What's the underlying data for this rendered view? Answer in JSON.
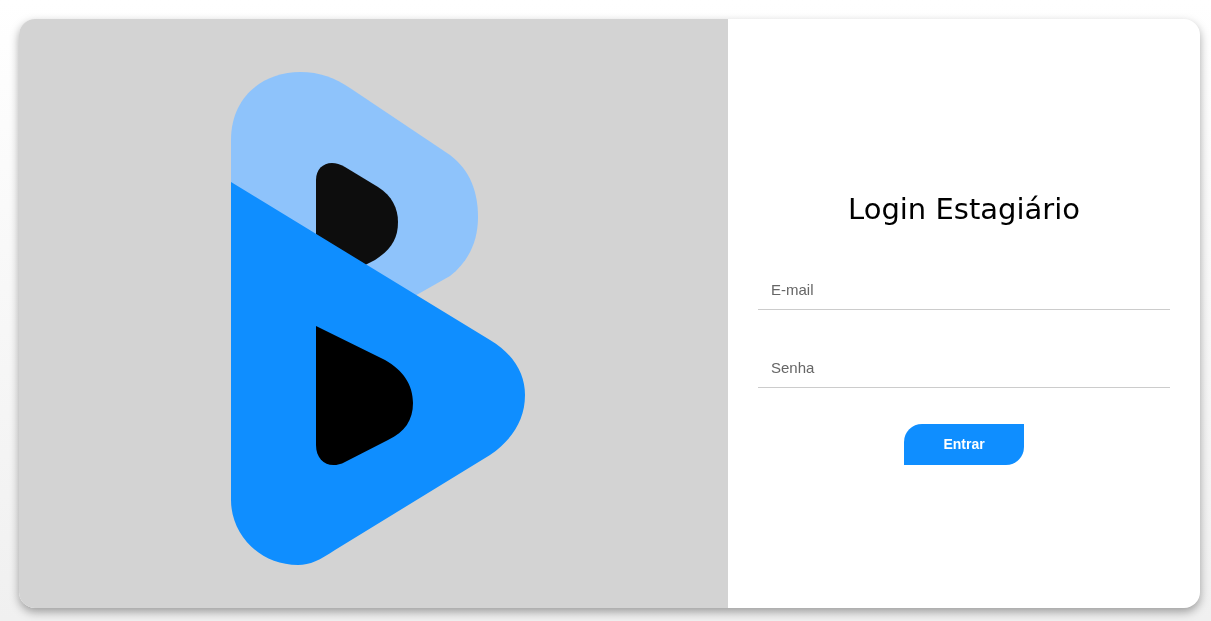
{
  "login": {
    "title": "Login Estagiário",
    "fields": [
      {
        "placeholder": "E-mail"
      },
      {
        "placeholder": "Senha"
      }
    ],
    "button": "Entrar"
  }
}
